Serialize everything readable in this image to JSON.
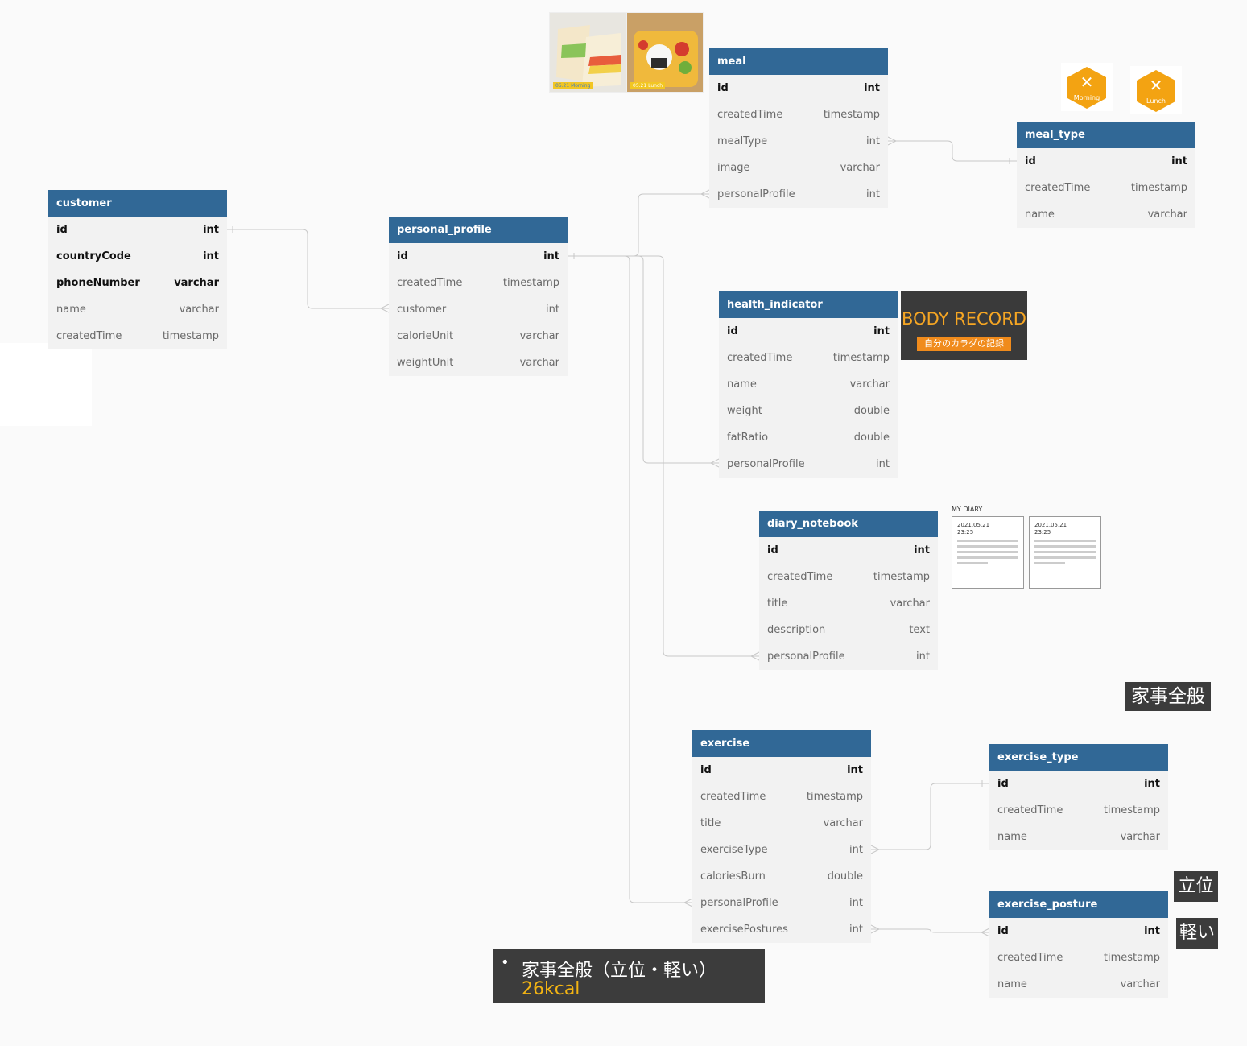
{
  "tables": {
    "customer": {
      "name": "customer",
      "rows": [
        [
          "id",
          "int"
        ],
        [
          "countryCode",
          "int"
        ],
        [
          "phoneNumber",
          "varchar"
        ],
        [
          "name",
          "varchar"
        ],
        [
          "createdTime",
          "timestamp"
        ]
      ]
    },
    "personal_profile": {
      "name": "personal_profile",
      "rows": [
        [
          "id",
          "int"
        ],
        [
          "createdTime",
          "timestamp"
        ],
        [
          "customer",
          "int"
        ],
        [
          "calorieUnit",
          "varchar"
        ],
        [
          "weightUnit",
          "varchar"
        ]
      ]
    },
    "meal": {
      "name": "meal",
      "rows": [
        [
          "id",
          "int"
        ],
        [
          "createdTime",
          "timestamp"
        ],
        [
          "mealType",
          "int"
        ],
        [
          "image",
          "varchar"
        ],
        [
          "personalProfile",
          "int"
        ]
      ]
    },
    "meal_type": {
      "name": "meal_type",
      "rows": [
        [
          "id",
          "int"
        ],
        [
          "createdTime",
          "timestamp"
        ],
        [
          "name",
          "varchar"
        ]
      ]
    },
    "health_indicator": {
      "name": "health_indicator",
      "rows": [
        [
          "id",
          "int"
        ],
        [
          "createdTime",
          "timestamp"
        ],
        [
          "name",
          "varchar"
        ],
        [
          "weight",
          "double"
        ],
        [
          "fatRatio",
          "double"
        ],
        [
          "personalProfile",
          "int"
        ]
      ]
    },
    "diary_notebook": {
      "name": "diary_notebook",
      "rows": [
        [
          "id",
          "int"
        ],
        [
          "createdTime",
          "timestamp"
        ],
        [
          "title",
          "varchar"
        ],
        [
          "description",
          "text"
        ],
        [
          "personalProfile",
          "int"
        ]
      ]
    },
    "exercise": {
      "name": "exercise",
      "rows": [
        [
          "id",
          "int"
        ],
        [
          "createdTime",
          "timestamp"
        ],
        [
          "title",
          "varchar"
        ],
        [
          "exerciseType",
          "int"
        ],
        [
          "caloriesBurn",
          "double"
        ],
        [
          "personalProfile",
          "int"
        ],
        [
          "exercisePostures",
          "int"
        ]
      ]
    },
    "exercise_type": {
      "name": "exercise_type",
      "rows": [
        [
          "id",
          "int"
        ],
        [
          "createdTime",
          "timestamp"
        ],
        [
          "name",
          "varchar"
        ]
      ]
    },
    "exercise_posture": {
      "name": "exercise_posture",
      "rows": [
        [
          "id",
          "int"
        ],
        [
          "createdTime",
          "timestamp"
        ],
        [
          "name",
          "varchar"
        ]
      ]
    }
  },
  "photos": {
    "tag1": "05.21 Morning",
    "tag2": "05.21 Lunch"
  },
  "badges": {
    "morning": "Morning",
    "lunch": "Lunch"
  },
  "body_record": {
    "title": "BODY RECORD",
    "subtitle": "自分のカラダの記録"
  },
  "diary": {
    "title": "MY DIARY",
    "entries": [
      {
        "date": "2021.05.21",
        "time": "23:25"
      },
      {
        "date": "2021.05.21",
        "time": "23:25"
      }
    ]
  },
  "labels": {
    "housework": "家事全般",
    "standing": "立位",
    "light": "軽い"
  },
  "bullet": {
    "line1": "家事全般（立位・軽い）",
    "line2": "26kcal"
  }
}
